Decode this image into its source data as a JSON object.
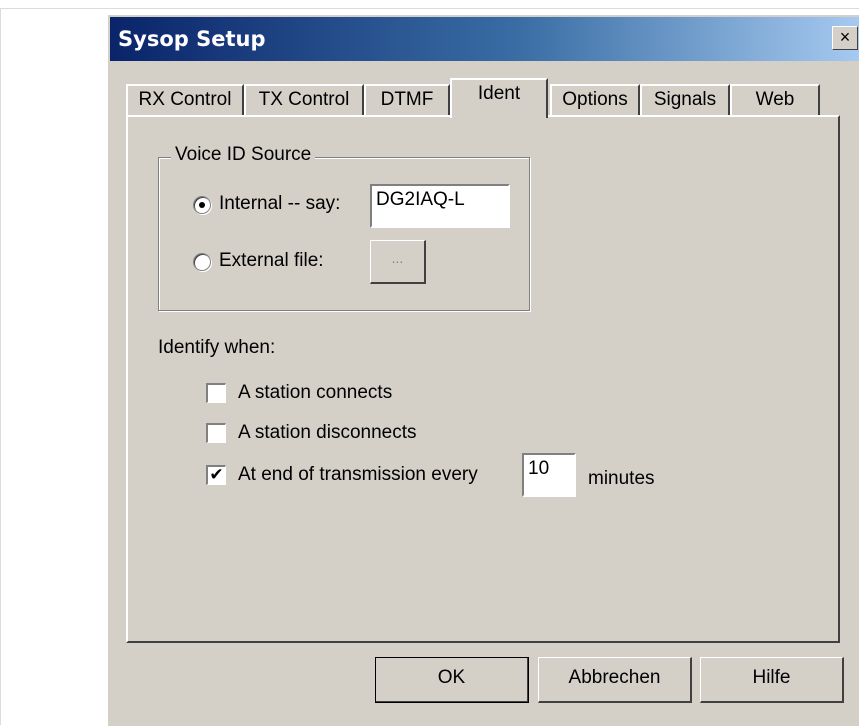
{
  "window": {
    "title": "Sysop Setup",
    "close_glyph": "×"
  },
  "tabs": [
    {
      "label": "RX Control"
    },
    {
      "label": "TX Control"
    },
    {
      "label": "DTMF"
    },
    {
      "label": "Ident",
      "active": true
    },
    {
      "label": "Options"
    },
    {
      "label": "Signals"
    },
    {
      "label": "Web"
    }
  ],
  "voice_id": {
    "group_label": "Voice ID Source",
    "internal_label": "Internal -- say:",
    "internal_value": "DG2IAQ-L",
    "internal_selected": true,
    "external_label": "External file:",
    "browse_label": "..."
  },
  "identify": {
    "heading": "Identify when:",
    "options": [
      {
        "label": "A station connects",
        "checked": false
      },
      {
        "label": "A station disconnects",
        "checked": false
      },
      {
        "label": "At end of transmission every",
        "checked": true
      }
    ],
    "minutes_value": "10",
    "minutes_label": "minutes"
  },
  "buttons": {
    "ok": "OK",
    "cancel": "Abbrechen",
    "help": "Hilfe"
  },
  "icons": {
    "check_glyph": "✔"
  },
  "colors": {
    "face": "#d4d0c8",
    "title_start": "#0a246a",
    "title_end": "#a6caf0"
  }
}
